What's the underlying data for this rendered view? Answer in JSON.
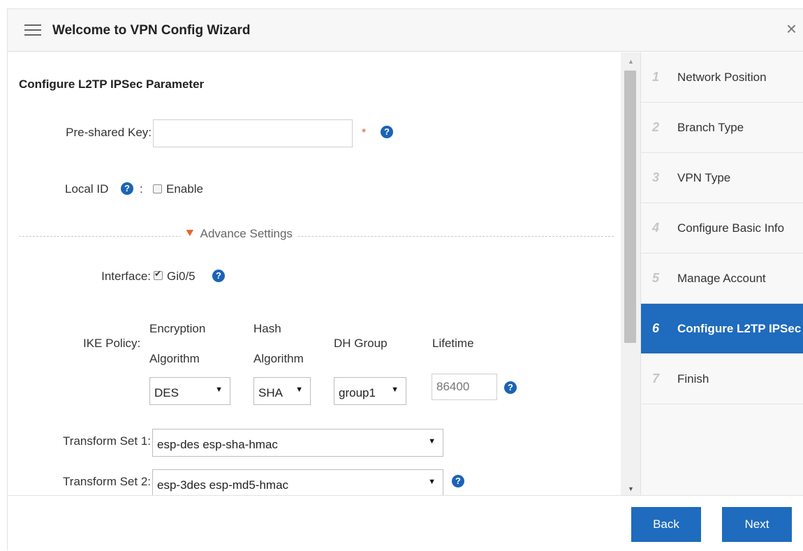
{
  "header": {
    "title": "Welcome to VPN Config Wizard",
    "close": "×"
  },
  "section": {
    "title": "Configure L2TP IPSec Parameter"
  },
  "fields": {
    "psk_label": "Pre-shared Key:",
    "psk_value": "",
    "required_mark": "*",
    "help": "?",
    "local_id_label": "Local ID",
    "colon": ":",
    "enable_label": "Enable",
    "enable_checked": false,
    "advance_label": "Advance Settings",
    "advance_chevron": "❯❯",
    "interface_label": "Interface:",
    "interface_option": "Gi0/5",
    "interface_checked": true
  },
  "ike": {
    "label": "IKE Policy:",
    "col_encryption_1": "Encryption",
    "col_encryption_2": "Algorithm",
    "col_hash_1": "Hash",
    "col_hash_2": "Algorithm",
    "col_dh": "DH Group",
    "col_lifetime": "Lifetime",
    "encryption": "DES",
    "hash": "SHA",
    "dh_group": "group1",
    "lifetime": "86400"
  },
  "transforms": {
    "set1_label": "Transform Set 1:",
    "set1_value": "esp-des esp-sha-hmac",
    "set2_label": "Transform Set 2:",
    "set2_value": "esp-3des esp-md5-hmac",
    "arrow": "▼"
  },
  "steps": [
    {
      "num": "1",
      "label": "Network Position"
    },
    {
      "num": "2",
      "label": "Branch Type"
    },
    {
      "num": "3",
      "label": "VPN Type"
    },
    {
      "num": "4",
      "label": "Configure Basic Info"
    },
    {
      "num": "5",
      "label": "Manage Account"
    },
    {
      "num": "6",
      "label": "Configure L2TP IPSec"
    },
    {
      "num": "7",
      "label": "Finish"
    }
  ],
  "active_step": 6,
  "footer": {
    "back": "Back",
    "next": "Next"
  },
  "colors": {
    "accent": "#1f6bbd",
    "required": "#e2553a",
    "chevron": "#e8642c"
  }
}
